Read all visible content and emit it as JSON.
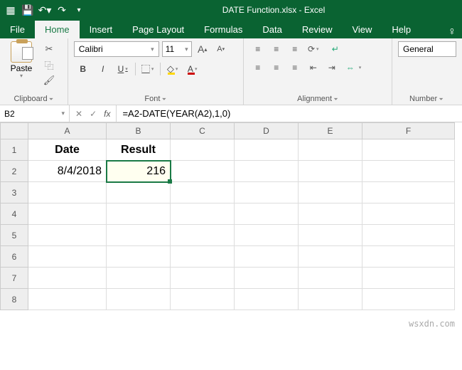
{
  "titlebar": {
    "filename": "DATE Function.xlsx  -  Excel"
  },
  "tabs": {
    "file": "File",
    "home": "Home",
    "insert": "Insert",
    "page_layout": "Page Layout",
    "formulas": "Formulas",
    "data": "Data",
    "review": "Review",
    "view": "View",
    "help": "Help"
  },
  "ribbon": {
    "clipboard": {
      "paste": "Paste",
      "label": "Clipboard"
    },
    "font": {
      "family": "Calibri",
      "size": "11",
      "bold": "B",
      "italic": "I",
      "underline": "U",
      "increase": "A",
      "decrease": "A",
      "color_glyph": "A",
      "label": "Font"
    },
    "alignment": {
      "wrap": "Wrap Text",
      "merge": "Merge & Center",
      "label": "Alignment"
    },
    "number": {
      "format": "General",
      "label": "Number"
    }
  },
  "formula_bar": {
    "name_box": "B2",
    "fx": "fx",
    "formula": "=A2-DATE(YEAR(A2),1,0)"
  },
  "grid": {
    "cols": [
      "A",
      "B",
      "C",
      "D",
      "E",
      "F"
    ],
    "rows": [
      "1",
      "2",
      "3",
      "4",
      "5",
      "6",
      "7",
      "8"
    ],
    "headers": {
      "A": "Date",
      "B": "Result"
    },
    "data": {
      "A2": "8/4/2018",
      "B2": "216"
    }
  },
  "watermark": "wsxdn.com"
}
